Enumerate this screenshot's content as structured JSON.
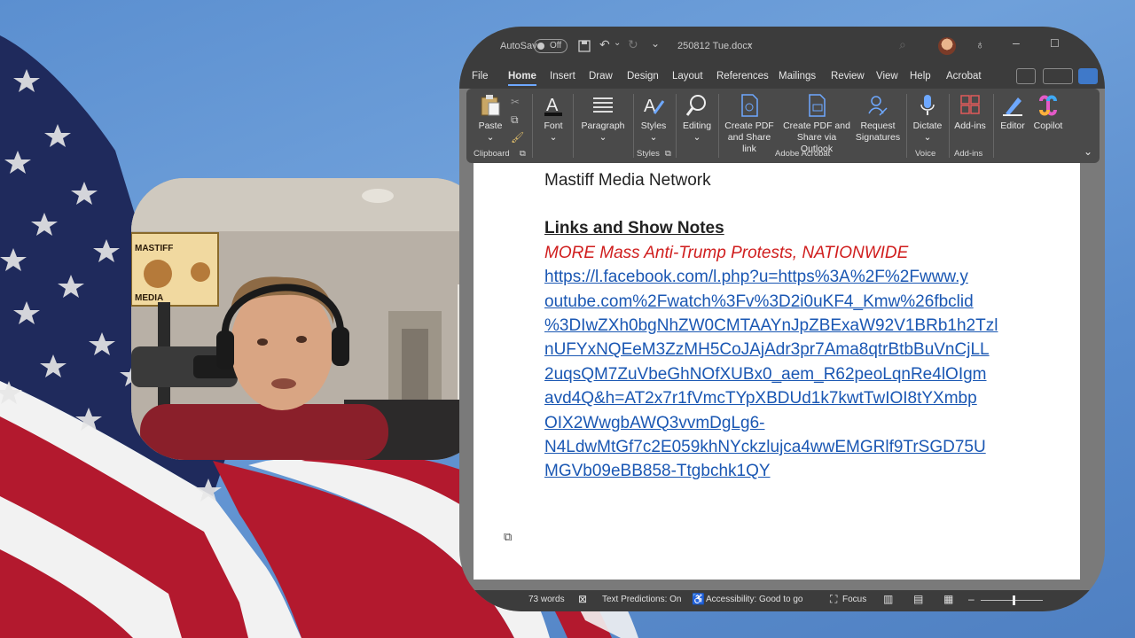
{
  "titlebar": {
    "autosave_label": "AutoSave",
    "autosave_state": "Off",
    "filename": "250812 Tue.docx"
  },
  "menu_tabs": [
    "File",
    "Home",
    "Insert",
    "Draw",
    "Design",
    "Layout",
    "References",
    "Mailings",
    "Review",
    "View",
    "Help",
    "Acrobat"
  ],
  "active_tab": "Home",
  "ribbon": {
    "paste": "Paste",
    "font": "Font",
    "paragraph": "Paragraph",
    "styles": "Styles",
    "editing": "Editing",
    "create_pdf_share_link_1": "Create PDF",
    "create_pdf_share_link_2": "and Share link",
    "create_pdf_outlook_1": "Create PDF and",
    "create_pdf_outlook_2": "Share via Outlook",
    "request_sig_1": "Request",
    "request_sig_2": "Signatures",
    "dictate": "Dictate",
    "addins": "Add-ins",
    "editor": "Editor",
    "copilot": "Copilot",
    "groups": {
      "clipboard": "Clipboard",
      "styles": "Styles",
      "adobe_acrobat": "Adobe Acrobat",
      "voice": "Voice",
      "addins": "Add-ins"
    }
  },
  "document": {
    "line1": "Mastiff Media Network",
    "heading": "Links and Show Notes",
    "red_headline": "MORE Mass Anti-Trump Protests, NATIONWIDE",
    "link_lines": [
      "https://l.facebook.com/l.php?u=https%3A%2F%2Fwww.y",
      "outube.com%2Fwatch%3Fv%3D2i0uKF4_Kmw%26fbclid",
      "%3DIwZXh0bgNhZW0CMTAAYnJpZBExaW92V1BRb1h2Tzl",
      "nUFYxNQEeM3ZzMH5CoJAjAdr3pr7Ama8qtrBtbBuVnCjLL",
      "2uqsQM7ZuVbeGhNOfXUBx0_aem_R62peoLqnRe4lOIgm",
      "avd4Q&h=AT2x7r1fVmcTYpXBDUd1k7kwtTwIOI8tYXmbp",
      "OIX2WwgbAWQ3vvmDgLg6-",
      "N4LdwMtGf7c2E059khNYckzlujca4wwEMGRlf9TrSGD75U",
      "MGVb09eBB858-Ttgbchk1QY"
    ]
  },
  "statusbar": {
    "words": "73 words",
    "text_predictions": "Text Predictions: On",
    "accessibility": "Accessibility: Good to go",
    "focus": "Focus"
  },
  "webcam": {
    "sign_line1": "MASTIFF",
    "sign_line2": "MEDIA"
  },
  "colors": {
    "background_blue": "#5b8fd0",
    "flag_red": "#b3192e",
    "flag_navy": "#1f2a5c",
    "link_blue": "#1a57b3",
    "headline_red": "#d01e1e"
  }
}
